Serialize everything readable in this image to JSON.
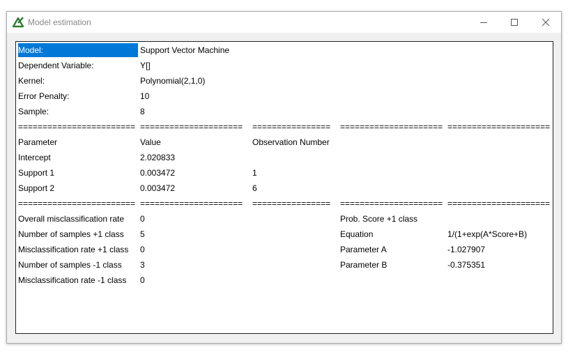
{
  "window": {
    "title": "Model estimation"
  },
  "rows": [
    [
      "Model:",
      "Support Vector Machine",
      "",
      "",
      ""
    ],
    [
      "Dependent Variable:",
      "Y[]",
      "",
      "",
      ""
    ],
    [
      "Kernel:",
      "Polynomial(2,1,0)",
      "",
      "",
      ""
    ],
    [
      "Error Penalty:",
      "10",
      "",
      "",
      ""
    ],
    [
      "Sample:",
      "8",
      "",
      "",
      ""
    ],
    [
      "========================",
      "=====================",
      "================",
      "=====================",
      "====================="
    ],
    [
      "Parameter",
      "Value",
      "Observation Number",
      "",
      ""
    ],
    [
      "Intercept",
      "2.020833",
      "",
      "",
      ""
    ],
    [
      "Support 1",
      "0.003472",
      "1",
      "",
      ""
    ],
    [
      "Support 2",
      "0.003472",
      "6",
      "",
      ""
    ],
    [
      "========================",
      "=====================",
      "================",
      "=====================",
      "====================="
    ],
    [
      "Overall misclassification rate",
      "0",
      "",
      "Prob. Score +1 class",
      ""
    ],
    [
      "Number of samples +1 class",
      "5",
      "",
      "Equation",
      "1/(1+exp(A*Score+B)"
    ],
    [
      "Misclassification rate +1 class",
      "0",
      "",
      "Parameter A",
      "-1.027907"
    ],
    [
      "Number of samples -1 class",
      "3",
      "",
      "Parameter B",
      "-0.375351"
    ],
    [
      "Misclassification rate -1 class",
      "0",
      "",
      "",
      ""
    ]
  ],
  "colors": {
    "selection": "#0078d7",
    "icon": "#2e7d32"
  }
}
